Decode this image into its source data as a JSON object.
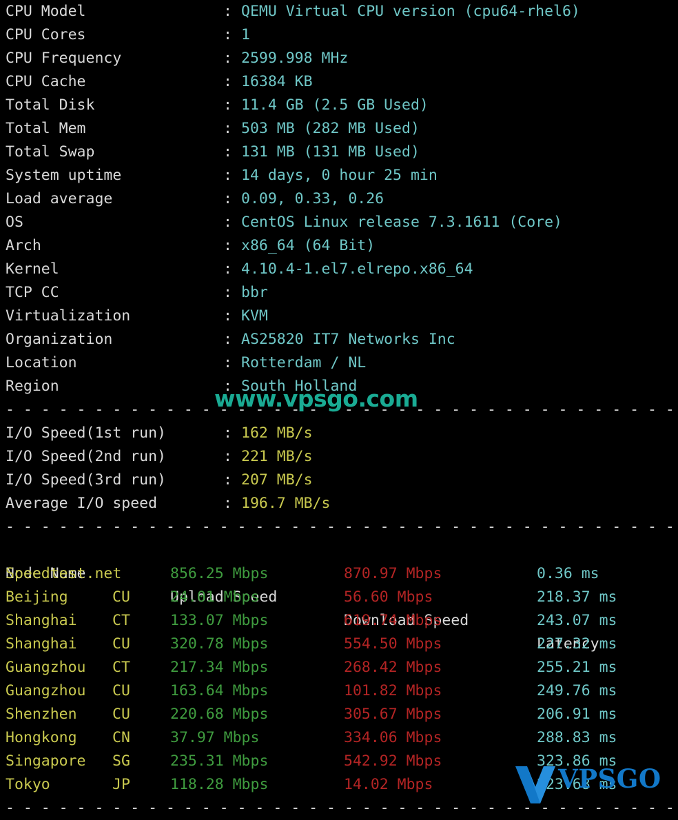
{
  "terminal": {
    "separator_line": "----------------------------------------------------------------------",
    "background": "#000000",
    "colors": {
      "label": "#d8d8d8",
      "value_cyan": "#6fc7c7",
      "value_yellow": "#c9c94f",
      "upload_green": "#3f9c3f",
      "download_red": "#b32424",
      "latency_cyan": "#6fc7c7",
      "watermark_teal": "#1aab94",
      "watermark_blue": "#1278c8"
    }
  },
  "system_info": [
    {
      "label": "CPU Model",
      "value": "QEMU Virtual CPU version (cpu64-rhel6)"
    },
    {
      "label": "CPU Cores",
      "value": "1"
    },
    {
      "label": "CPU Frequency",
      "value": "2599.998 MHz"
    },
    {
      "label": "CPU Cache",
      "value": "16384 KB"
    },
    {
      "label": "Total Disk",
      "value": "11.4 GB (2.5 GB Used)"
    },
    {
      "label": "Total Mem",
      "value": "503 MB (282 MB Used)"
    },
    {
      "label": "Total Swap",
      "value": "131 MB (131 MB Used)"
    },
    {
      "label": "System uptime",
      "value": "14 days, 0 hour 25 min"
    },
    {
      "label": "Load average",
      "value": "0.09, 0.33, 0.26"
    },
    {
      "label": "OS",
      "value": "CentOS Linux release 7.3.1611 (Core)"
    },
    {
      "label": "Arch",
      "value": "x86_64 (64 Bit)"
    },
    {
      "label": "Kernel",
      "value": "4.10.4-1.el7.elrepo.x86_64"
    },
    {
      "label": "TCP CC",
      "value": "bbr"
    },
    {
      "label": "Virtualization",
      "value": "KVM"
    },
    {
      "label": "Organization",
      "value": "AS25820 IT7 Networks Inc"
    },
    {
      "label": "Location",
      "value": "Rotterdam / NL"
    },
    {
      "label": "Region",
      "value": "South Holland"
    }
  ],
  "io_speed": [
    {
      "label": "I/O Speed(1st run)",
      "value": "162 MB/s"
    },
    {
      "label": "I/O Speed(2nd run)",
      "value": "221 MB/s"
    },
    {
      "label": "I/O Speed(3rd run)",
      "value": "207 MB/s"
    },
    {
      "label": "Average I/O speed",
      "value": "196.7 MB/s"
    }
  ],
  "speedtest": {
    "headers": {
      "node": "Node Name",
      "upload": "Upload Speed",
      "download": "Download Speed",
      "latency": "Latency"
    },
    "rows": [
      {
        "node": "Speedtest.net",
        "isp": "",
        "upload": "856.25 Mbps",
        "download": "870.97 Mbps",
        "latency": "0.36 ms"
      },
      {
        "node": "Beijing",
        "isp": "CU",
        "upload": "24.01 Mbps",
        "download": "56.60 Mbps",
        "latency": "218.37 ms"
      },
      {
        "node": "Shanghai",
        "isp": "CT",
        "upload": "133.07 Mbps",
        "download": "619.74 Mbps",
        "latency": "243.07 ms"
      },
      {
        "node": "Shanghai",
        "isp": "CU",
        "upload": "320.78 Mbps",
        "download": "554.50 Mbps",
        "latency": "227.32 ms"
      },
      {
        "node": "Guangzhou",
        "isp": "CT",
        "upload": "217.34 Mbps",
        "download": "268.42 Mbps",
        "latency": "255.21 ms"
      },
      {
        "node": "Guangzhou",
        "isp": "CU",
        "upload": "163.64 Mbps",
        "download": "101.82 Mbps",
        "latency": "249.76 ms"
      },
      {
        "node": "Shenzhen",
        "isp": "CU",
        "upload": "220.68 Mbps",
        "download": "305.67 Mbps",
        "latency": "206.91 ms"
      },
      {
        "node": "Hongkong",
        "isp": "CN",
        "upload": "37.97 Mbps",
        "download": "334.06 Mbps",
        "latency": "288.83 ms"
      },
      {
        "node": "Singapore",
        "isp": "SG",
        "upload": "235.31 Mbps",
        "download": "542.92 Mbps",
        "latency": "323.86 ms"
      },
      {
        "node": "Tokyo",
        "isp": "JP",
        "upload": "118.28 Mbps",
        "download": "14.02 Mbps",
        "latency": "223.68 ms"
      }
    ]
  },
  "watermarks": {
    "text": "www.vpsgo.com",
    "logo_word": "VPSGO"
  }
}
